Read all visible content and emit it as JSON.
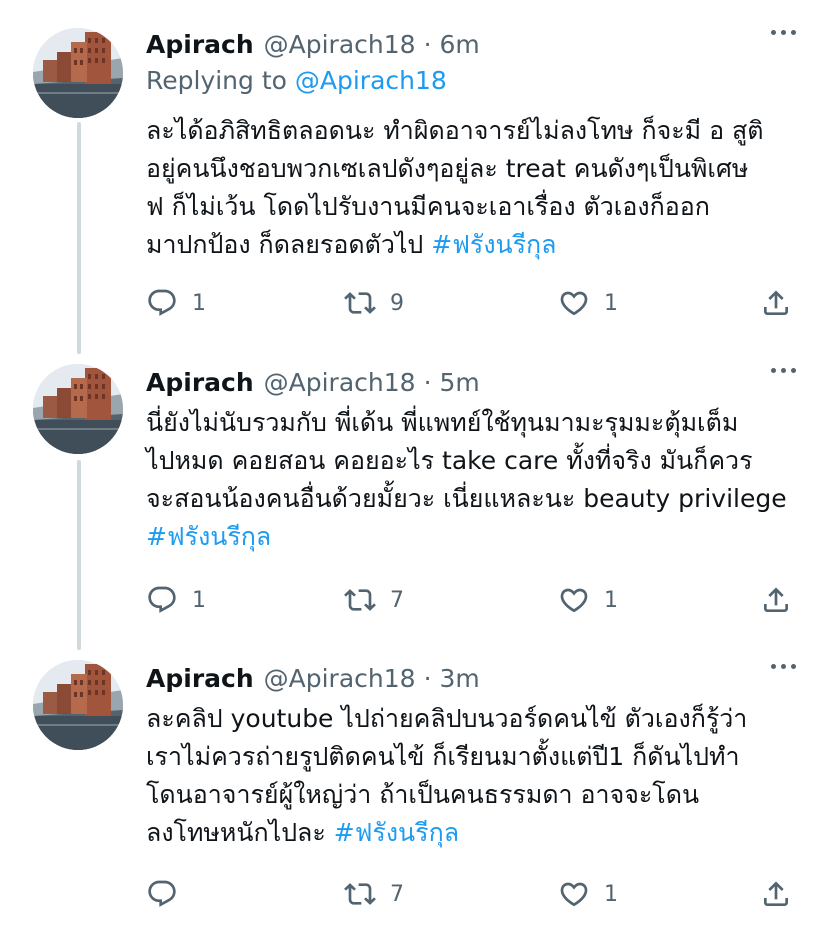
{
  "tweets": [
    {
      "name": "Apirach",
      "handle": "@Apirach18",
      "sep": "·",
      "time": "6m",
      "replying_prefix": "Replying to ",
      "replying_to": "@Apirach18",
      "lines": [
        "ละได้อภิสิทธิตลอดนะ ทำผิดอาจารย์ไม่ลงโทษ ก็จะมี อ สูติ",
        "อยู่คนนึงชอบพวกเซเลปดังๆอยู่ละ treat คนดังๆเป็นพิเศษ",
        "ฟ ก็ไม่เว้น โดดไปรับงานมีคนจะเอาเรื่อง ตัวเองก็ออก",
        "มาปกป้อง ก็ดลยรอดตัวไป "
      ],
      "hashtag": "#ฟรังนรีกุล",
      "replies": "1",
      "retweets": "9",
      "likes": "1"
    },
    {
      "name": "Apirach",
      "handle": "@Apirach18",
      "sep": "·",
      "time": "5m",
      "lines": [
        "นี่ยังไม่นับรวมกับ พี่เด้น พี่แพทย์ใช้ทุนมามะรุมมะตุ้มเต็ม",
        "ไปหมด คอยสอน คอยอะไร take care ทั้งที่จริง มันก็ควร",
        "จะสอนน้องคนอื่นด้วยมั้ยวะ เนี่ยแหละนะ beauty privilege",
        ""
      ],
      "hashtag": "#ฟรังนรีกุล",
      "replies": "1",
      "retweets": "7",
      "likes": "1"
    },
    {
      "name": "Apirach",
      "handle": "@Apirach18",
      "sep": "·",
      "time": "3m",
      "lines": [
        "ละคลิป youtube ไปถ่ายคลิปบนวอร์ดคนไข้ ตัวเองก็รู้ว่า",
        "เราไม่ควรถ่ายรูปติดคนไข้ ก็เรียนมาตั้งแต่ปี1 ก็ดันไปทำ",
        "โดนอาจารย์ผู้ใหญ่ว่า ถ้าเป็นคนธรรมดา อาจจะโดน",
        "ลงโทษหนักไปละ "
      ],
      "hashtag": "#ฟรังนรีกุล",
      "retweets": "7",
      "likes": "1"
    }
  ],
  "icons": {
    "reply": "reply-icon",
    "retweet": "retweet-icon",
    "like": "heart-icon",
    "share": "share-icon",
    "more": "more-options-icon"
  },
  "colors": {
    "link": "#1d9bf0",
    "secondary": "#536471",
    "text": "#0f1419",
    "thread": "#cfd9de"
  }
}
